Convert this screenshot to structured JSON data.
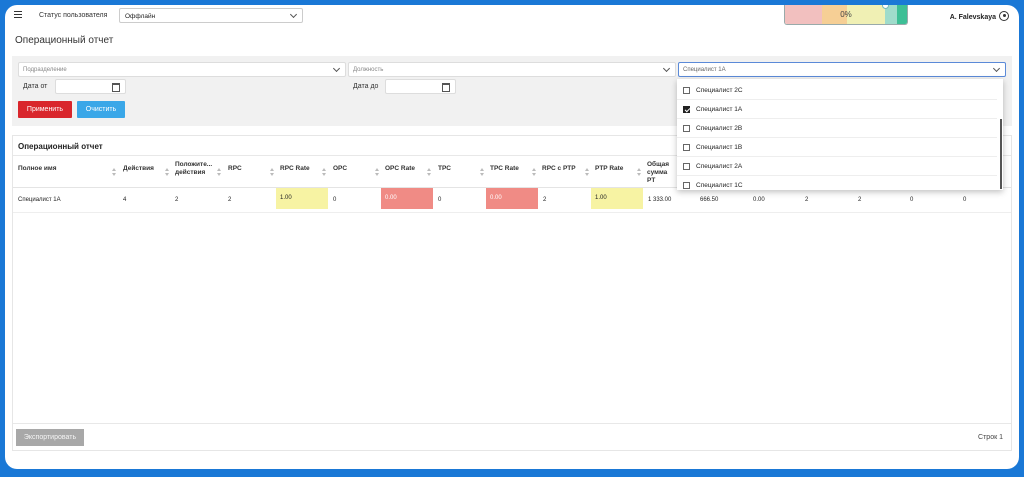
{
  "header": {
    "status_label": "Статус пользователя",
    "status_value": "Оффлайн",
    "progress_text": "0%",
    "progress_percent": 0,
    "user_name": "A. Falevskaya"
  },
  "page": {
    "title": "Операционный отчет"
  },
  "filters": {
    "division_placeholder": "Подразделение",
    "position_placeholder": "Должность",
    "specialist_value": "Специалист 1А",
    "date_from_label": "Дата от",
    "date_to_label": "Дата до",
    "apply_label": "Применить",
    "clear_label": "Очистить"
  },
  "dropdown": {
    "options": [
      {
        "label": "Специалист 2С",
        "checked": false
      },
      {
        "label": "Специалист 1А",
        "checked": true
      },
      {
        "label": "Специалист 2В",
        "checked": false
      },
      {
        "label": "Специалист 1В",
        "checked": false
      },
      {
        "label": "Специалист 2А",
        "checked": false
      },
      {
        "label": "Специалист 1С",
        "checked": false
      }
    ]
  },
  "report": {
    "title": "Операционный отчет",
    "columns": [
      "Полное имя",
      "Действия",
      "Положите... действия",
      "RPC",
      "RPC Rate",
      "OPC",
      "OPC Rate",
      "TPC",
      "TPC Rate",
      "RPC с PTP",
      "PTP Rate",
      "Общая сумма PT"
    ],
    "row": [
      "Специалист 1А",
      "4",
      "2",
      "2",
      "1.00",
      "0",
      "0.00",
      "0",
      "0.00",
      "2",
      "1.00",
      "1 333.00",
      "666.50",
      "0.00",
      "2",
      "2",
      "0",
      "0"
    ],
    "export_label": "Экспортировать",
    "rows_count_text": "Строк 1"
  },
  "colors": {
    "highlight_yellow": "#f7f3a3",
    "highlight_red": "#f08b85",
    "apply_button": "#d9262c",
    "clear_button": "#3aa7e8",
    "frame_blue": "#1a78d6"
  }
}
